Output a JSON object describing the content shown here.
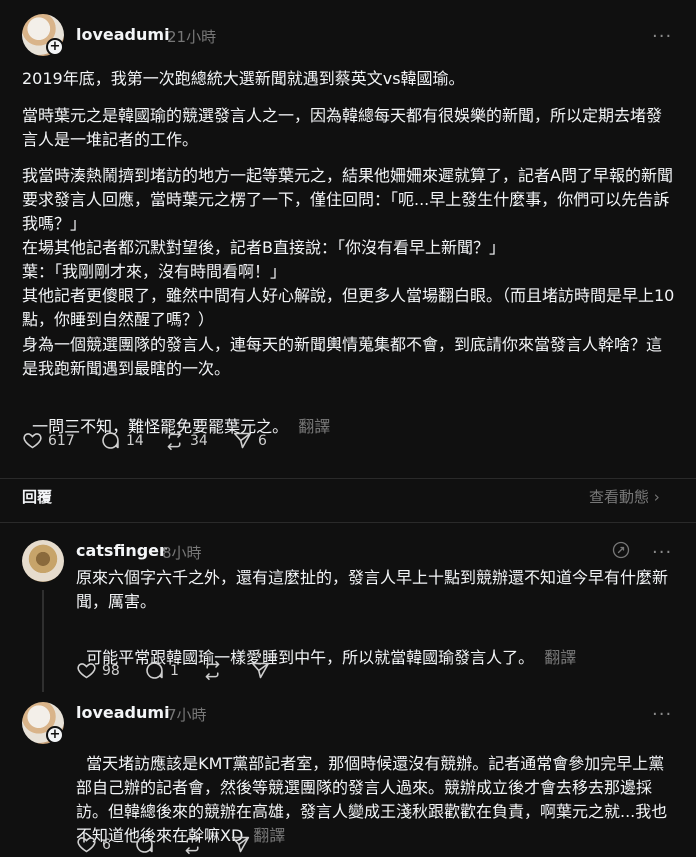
{
  "post": {
    "username": "loveadumi",
    "time": "21小時",
    "paragraphs": [
      "2019年底，我第一次跑總統大選新聞就遇到蔡英文vs韓國瑜。",
      "當時葉元之是韓國瑜的競選發言人之一，因為韓總每天都有很娛樂的新聞，所以定期去堵發言人是一堆記者的工作。",
      "我當時湊熱鬧擠到堵訪的地方一起等葉元之，結果他姍姍來遲就算了，記者A問了早報的新聞要求發言人回應，當時葉元之楞了一下，僅住回問：「呃...早上發生什麼事，你們可以先告訴我嗎？」\n在場其他記者都沉默對望後，記者B直接說：「你沒有看早上新聞？」\n葉：「我剛剛才來，沒有時間看啊！」\n其他記者更傻眼了，雖然中間有人好心解說，但更多人當場翻白眼。（而且堵訪時間是早上10點，你睡到自然醒了嗎？）",
      "身為一個競選團隊的發言人，連每天的新聞輿情蒐集都不會，到底請你來當發言人幹啥？這是我跑新聞遇到最瞎的一次。",
      "一問三不知，難怪罷免要罷葉元之。"
    ],
    "translate": "翻譯",
    "likes": "617",
    "comments": "14",
    "reposts": "34",
    "shares": "6"
  },
  "replies_header": {
    "label": "回覆",
    "view_activity": "查看動態 ›"
  },
  "replies": [
    {
      "username": "catsfinger",
      "time": "8小時",
      "paragraphs": [
        "原來六個字六千之外，還有這麼扯的，發言人早上十點到競辦還不知道今早有什麼新聞，厲害。",
        "可能平常跟韓國瑜一樣愛睡到中午，所以就當韓國瑜發言人了。"
      ],
      "translate": "翻譯",
      "likes": "98",
      "comments": "1"
    },
    {
      "username": "loveadumi",
      "time": "7小時",
      "paragraphs": [
        "當天堵訪應該是KMT黨部記者室，那個時候還沒有競辦。記者通常會參加完早上黨部自己辦的記者會，然後等競選團隊的發言人過來。競辦成立後才會去移去那邊採訪。但韓總後來的競辦在高雄，發言人變成王淺秋跟歡歡在負責，啊葉元之就...我也不知道他後來在幹嘛XD"
      ],
      "translate": "翻譯",
      "likes": "6"
    }
  ]
}
